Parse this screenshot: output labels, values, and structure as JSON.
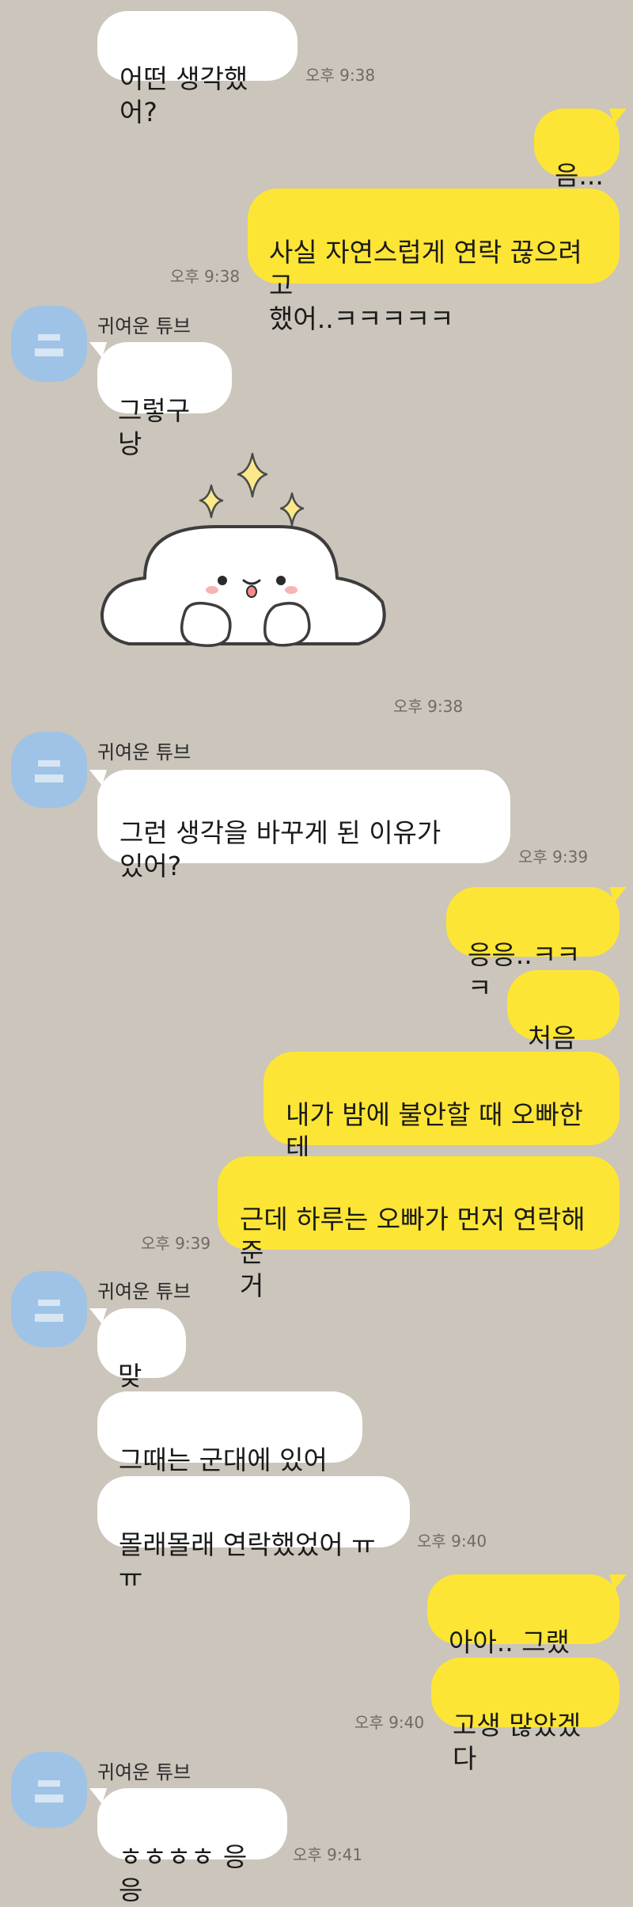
{
  "colors": {
    "background": "#cbc5bb",
    "incoming_bubble": "#ffffff",
    "outgoing_bubble": "#fde535",
    "avatar": "#9ec3e6"
  },
  "messages": {
    "m1": {
      "text": "어떤 생각했어?",
      "time": "오후 9:38"
    },
    "m2": {
      "text": "음..."
    },
    "m3": {
      "text": "사실 자연스럽게 연락 끊으려고\n했어..ㅋㅋㅋㅋㅋ",
      "time": "오후 9:38"
    },
    "g1": {
      "sender": "귀여운 튜브"
    },
    "m4": {
      "text": "그렇구낭"
    },
    "m5": {
      "sticker": "white-seal-sticker-icon",
      "time": "오후 9:38"
    },
    "g2": {
      "sender": "귀여운 튜브"
    },
    "m6": {
      "text": "그런 생각을 바꾸게 된 이유가\n있어?",
      "time": "오후 9:39"
    },
    "m7": {
      "text": "응응..ㅋㅋㅋ"
    },
    "m8": {
      "text": "처음에"
    },
    "m9": {
      "text": "내가 밤에 불안할 때 오빠한테\n자냐고 물어봤었잖아"
    },
    "m10": {
      "text": "근데 하루는 오빠가 먼저 연락해준\n거",
      "time": "오후 9:39"
    },
    "g3": {
      "sender": "귀여운 튜브"
    },
    "m11": {
      "text": "맞아"
    },
    "m12": {
      "text": "그때는 군대에 있어서"
    },
    "m13": {
      "text": "몰래몰래 연락했었어 ㅠㅠ",
      "time": "오후 9:40"
    },
    "m14": {
      "text": "아아.. 그랬지.."
    },
    "m15": {
      "text": "고생 많았겠다",
      "time": "오후 9:40"
    },
    "g4": {
      "sender": "귀여운 튜브"
    },
    "m16": {
      "text": "ㅎㅎㅎㅎ 응응",
      "time": "오후 9:41"
    }
  }
}
